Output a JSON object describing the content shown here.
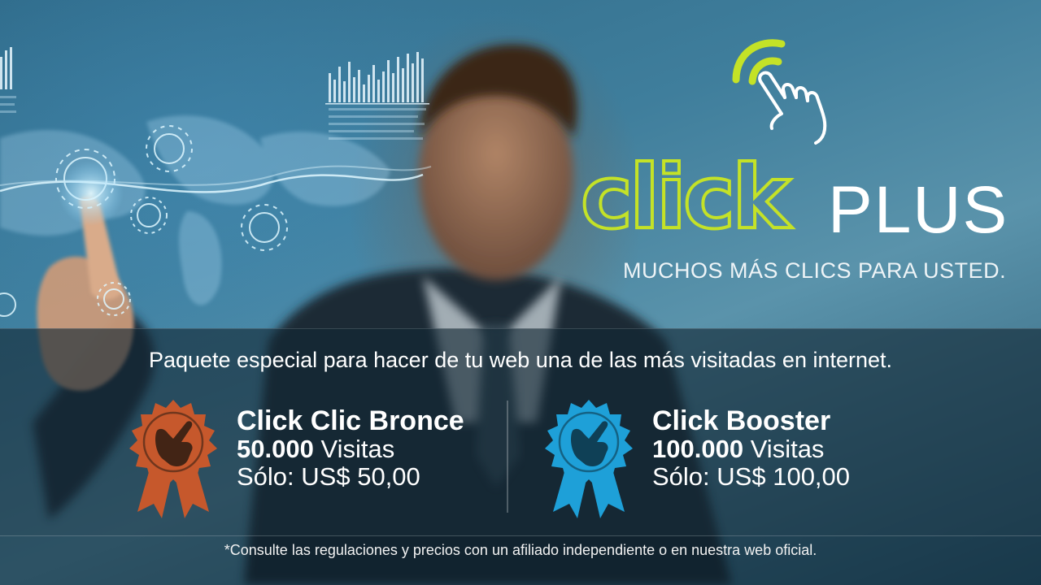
{
  "brand": {
    "logo_word_click": "click",
    "logo_word_plus": "PLUS",
    "tagline": "MUCHOS MÁS CLICS PARA USTED.",
    "accent_color": "#c4e227"
  },
  "offer": {
    "headline": "Paquete especial para hacer de tu web una de las más visitadas en internet."
  },
  "packages": [
    {
      "name": "Click Clic Bronce",
      "visits_number": "50.000",
      "visits_label": "Visitas",
      "price_label": "Sólo:",
      "price_value": "US$ 50,00",
      "badge_color": "#c6582c",
      "icon": "pointing-hand-rosette-icon"
    },
    {
      "name": "Click Booster",
      "visits_number": "100.000",
      "visits_label": "Visitas",
      "price_label": "Sólo:",
      "price_value": "US$ 100,00",
      "badge_color": "#1ea0d8",
      "icon": "pointing-hand-rosette-icon"
    }
  ],
  "footer": {
    "disclaimer": "*Consulte las regulaciones y precios con un afiliado independiente o en nuestra web oficial."
  }
}
